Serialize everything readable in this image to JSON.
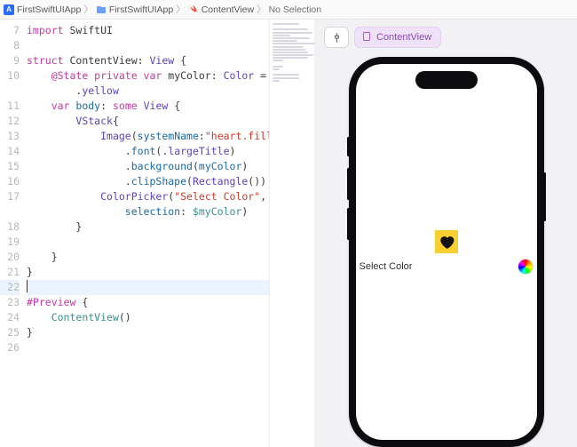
{
  "breadcrumb": {
    "app": "FirstSwiftUIApp",
    "folder": "FirstSwiftUIApp",
    "file": "ContentView",
    "selection": "No Selection"
  },
  "editor": {
    "line_start": 7,
    "current_line": 22,
    "lines": [
      {
        "n": 7,
        "indent": 0,
        "tokens": [
          {
            "t": "import ",
            "c": "kw"
          },
          {
            "t": "SwiftUI",
            "c": "plain"
          }
        ]
      },
      {
        "n": 8,
        "indent": 0,
        "tokens": []
      },
      {
        "n": 9,
        "indent": 0,
        "tokens": [
          {
            "t": "struct ",
            "c": "kw"
          },
          {
            "t": "ContentView",
            "c": "plain"
          },
          {
            "t": ": ",
            "c": "plain"
          },
          {
            "t": "View",
            "c": "type"
          },
          {
            "t": " {",
            "c": "plain"
          }
        ]
      },
      {
        "n": 10,
        "indent": 1,
        "tokens": [
          {
            "t": "@State ",
            "c": "kw"
          },
          {
            "t": "private var ",
            "c": "kw"
          },
          {
            "t": "myColor",
            "c": "plain"
          },
          {
            "t": ": ",
            "c": "plain"
          },
          {
            "t": "Color",
            "c": "type"
          },
          {
            "t": " =",
            "c": "plain"
          }
        ]
      },
      {
        "n": "",
        "indent": 2,
        "tokens": [
          {
            "t": ".",
            "c": "plain"
          },
          {
            "t": "yellow",
            "c": "param"
          }
        ]
      },
      {
        "n": 11,
        "indent": 1,
        "tokens": [
          {
            "t": "var ",
            "c": "kw"
          },
          {
            "t": "body",
            "c": "ident"
          },
          {
            "t": ": ",
            "c": "plain"
          },
          {
            "t": "some ",
            "c": "kw"
          },
          {
            "t": "View",
            "c": "type"
          },
          {
            "t": " {",
            "c": "plain"
          }
        ]
      },
      {
        "n": 12,
        "indent": 2,
        "tokens": [
          {
            "t": "VStack",
            "c": "type"
          },
          {
            "t": "{",
            "c": "plain"
          }
        ]
      },
      {
        "n": 13,
        "indent": 3,
        "tokens": [
          {
            "t": "Image",
            "c": "type"
          },
          {
            "t": "(",
            "c": "plain"
          },
          {
            "t": "systemName",
            "c": "ident"
          },
          {
            "t": ":",
            "c": "plain"
          },
          {
            "t": "\"heart.fill\"",
            "c": "str"
          },
          {
            "t": ")",
            "c": "plain"
          }
        ]
      },
      {
        "n": 14,
        "indent": 4,
        "tokens": [
          {
            "t": ".",
            "c": "plain"
          },
          {
            "t": "font",
            "c": "ident"
          },
          {
            "t": "(.",
            "c": "plain"
          },
          {
            "t": "largeTitle",
            "c": "param"
          },
          {
            "t": ")",
            "c": "plain"
          }
        ]
      },
      {
        "n": 15,
        "indent": 4,
        "tokens": [
          {
            "t": ".",
            "c": "plain"
          },
          {
            "t": "background",
            "c": "ident"
          },
          {
            "t": "(",
            "c": "plain"
          },
          {
            "t": "myColor",
            "c": "ident"
          },
          {
            "t": ")",
            "c": "plain"
          }
        ]
      },
      {
        "n": 16,
        "indent": 4,
        "tokens": [
          {
            "t": ".",
            "c": "plain"
          },
          {
            "t": "clipShape",
            "c": "ident"
          },
          {
            "t": "(",
            "c": "plain"
          },
          {
            "t": "Rectangle",
            "c": "type"
          },
          {
            "t": "())",
            "c": "plain"
          }
        ]
      },
      {
        "n": 17,
        "indent": 3,
        "tokens": [
          {
            "t": "ColorPicker",
            "c": "type"
          },
          {
            "t": "(",
            "c": "plain"
          },
          {
            "t": "\"Select Color\"",
            "c": "str"
          },
          {
            "t": ",",
            "c": "plain"
          }
        ]
      },
      {
        "n": "",
        "indent": 4,
        "tokens": [
          {
            "t": "selection",
            "c": "ident"
          },
          {
            "t": ": ",
            "c": "plain"
          },
          {
            "t": "$myColor",
            "c": "typeteal"
          },
          {
            "t": ")",
            "c": "plain"
          }
        ]
      },
      {
        "n": 18,
        "indent": 2,
        "tokens": [
          {
            "t": "}",
            "c": "plain"
          }
        ]
      },
      {
        "n": 19,
        "indent": 0,
        "tokens": []
      },
      {
        "n": 20,
        "indent": 1,
        "tokens": [
          {
            "t": "}",
            "c": "plain"
          }
        ]
      },
      {
        "n": 21,
        "indent": 0,
        "tokens": [
          {
            "t": "}",
            "c": "plain"
          }
        ]
      },
      {
        "n": 22,
        "indent": 0,
        "tokens": [],
        "current": true
      },
      {
        "n": 23,
        "indent": 0,
        "tokens": [
          {
            "t": "#Preview",
            "c": "kw"
          },
          {
            "t": " {",
            "c": "plain"
          }
        ]
      },
      {
        "n": 24,
        "indent": 1,
        "tokens": [
          {
            "t": "ContentView",
            "c": "typeteal"
          },
          {
            "t": "()",
            "c": "plain"
          }
        ]
      },
      {
        "n": 25,
        "indent": 0,
        "tokens": [
          {
            "t": "}",
            "c": "plain"
          }
        ]
      },
      {
        "n": 26,
        "indent": 0,
        "tokens": []
      }
    ]
  },
  "canvas": {
    "preview_label": "ContentView",
    "app": {
      "colorpicker_label": "Select Color",
      "heart_bg": "#f7cf2f"
    }
  }
}
